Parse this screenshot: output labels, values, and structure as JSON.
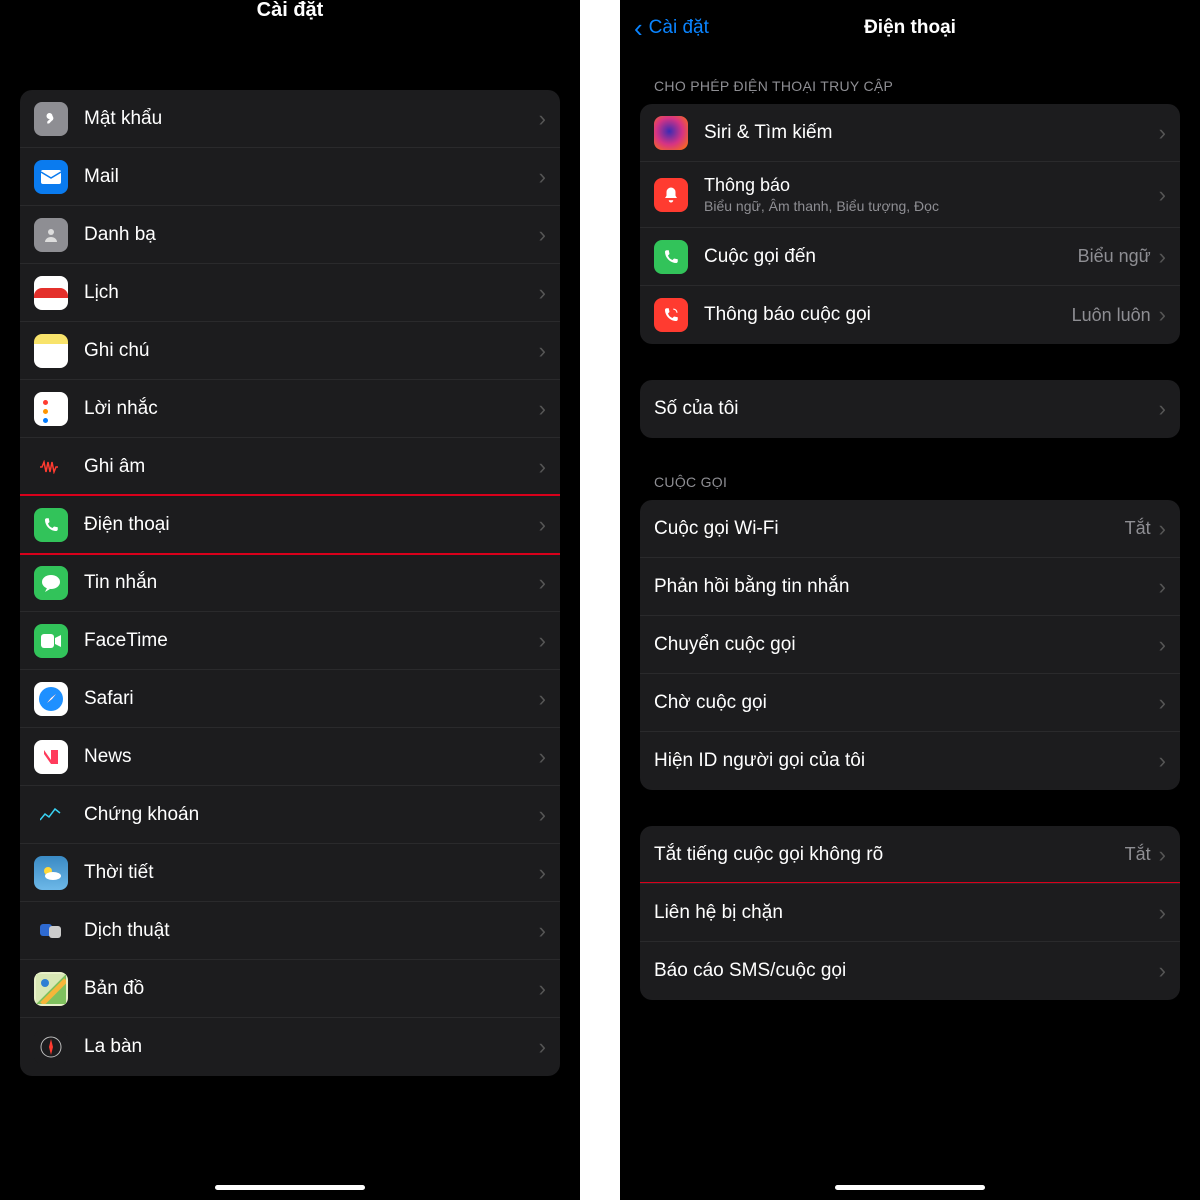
{
  "left": {
    "title": "Cài đặt",
    "items": [
      {
        "label": "Mật khẩu",
        "icon": "key"
      },
      {
        "label": "Mail",
        "icon": "mail"
      },
      {
        "label": "Danh bạ",
        "icon": "contacts"
      },
      {
        "label": "Lịch",
        "icon": "calendar"
      },
      {
        "label": "Ghi chú",
        "icon": "notes"
      },
      {
        "label": "Lời nhắc",
        "icon": "reminders"
      },
      {
        "label": "Ghi âm",
        "icon": "voice-memos"
      },
      {
        "label": "Điện thoại",
        "icon": "phone",
        "highlighted": true
      },
      {
        "label": "Tin nhắn",
        "icon": "messages"
      },
      {
        "label": "FaceTime",
        "icon": "facetime"
      },
      {
        "label": "Safari",
        "icon": "safari"
      },
      {
        "label": "News",
        "icon": "news"
      },
      {
        "label": "Chứng khoán",
        "icon": "stocks"
      },
      {
        "label": "Thời tiết",
        "icon": "weather"
      },
      {
        "label": "Dịch thuật",
        "icon": "translate"
      },
      {
        "label": "Bản đồ",
        "icon": "maps"
      },
      {
        "label": "La bàn",
        "icon": "compass"
      }
    ]
  },
  "right": {
    "back": "Cài đặt",
    "title": "Điện thoại",
    "section_access": "CHO PHÉP ĐIỆN THOẠI TRUY CẬP",
    "access": [
      {
        "label": "Siri & Tìm kiếm",
        "icon": "siri"
      },
      {
        "label": "Thông báo",
        "sub": "Biểu ngữ, Âm thanh, Biểu tượng, Đọc",
        "icon": "notifications"
      },
      {
        "label": "Cuộc gọi đến",
        "value": "Biểu ngữ",
        "icon": "incoming"
      },
      {
        "label": "Thông báo cuộc gọi",
        "value": "Luôn luôn",
        "icon": "announce"
      }
    ],
    "my_number": "Số của tôi",
    "section_calls": "CUỘC GỌI",
    "calls": [
      {
        "label": "Cuộc gọi Wi-Fi",
        "value": "Tắt"
      },
      {
        "label": "Phản hồi bằng tin nhắn"
      },
      {
        "label": "Chuyển cuộc gọi"
      },
      {
        "label": "Chờ cuộc gọi"
      },
      {
        "label": "Hiện ID người gọi của tôi"
      }
    ],
    "silence": [
      {
        "label": "Tắt tiếng cuộc gọi không rõ",
        "value": "Tắt",
        "highlighted": true
      },
      {
        "label": "Liên hệ bị chặn"
      },
      {
        "label": "Báo cáo SMS/cuộc gọi"
      }
    ]
  }
}
